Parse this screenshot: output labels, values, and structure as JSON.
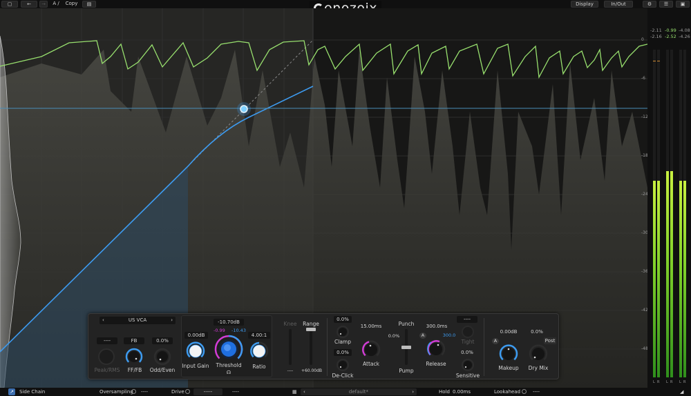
{
  "app": {
    "logo_text": "enozoix"
  },
  "toolbar": {
    "ab_label": "A /",
    "copy_label": "Copy",
    "display_label": "Display",
    "inout_label": "In/Out"
  },
  "graph": {
    "db_labels": [
      "0",
      "-6",
      "-12",
      "-18",
      "-24",
      "-30",
      "-36",
      "-42",
      "-48"
    ]
  },
  "meters": {
    "values_row1": [
      "-2.11",
      "-0.99",
      "-4.08"
    ],
    "values_row2": [
      "-2.16",
      "-2.52",
      "-4.26"
    ],
    "channel_labels": [
      "L",
      "R",
      "L",
      "R",
      "L",
      "R"
    ],
    "levels": [
      0.6,
      0.6,
      0.63,
      0.63,
      0.6,
      0.6
    ]
  },
  "panel": {
    "detector_mode": "US VCA",
    "peak_rms_value": "----",
    "peak_rms_label": "Peak/RMS",
    "fffb_value": "FB",
    "fffb_label": "FF/FB",
    "odd_even_value": "0.0%",
    "odd_even_label": "Odd/Even",
    "threshold_value": "-10.70dB",
    "threshold_left": "-0.99",
    "threshold_right": "-10.43",
    "threshold_label": "Threshold",
    "input_gain_value": "0.00dB",
    "input_gain_label": "Input Gain",
    "ratio_value": "4.00:1",
    "ratio_label": "Ratio",
    "knee_label": "Knee",
    "knee_value": "----",
    "range_label": "Range",
    "range_value": "+60.00dB",
    "clamp_value": "0.0%",
    "clamp_label": "Clamp",
    "declick_value": "0.0%",
    "declick_label": "De-Click",
    "attack_value": "15.00ms",
    "attack_label": "Attack",
    "punch_label": "Punch",
    "pump_label": "Pump",
    "punch_pump_value": "0.0%",
    "release_value": "300.0ms",
    "release_auto": "A",
    "release_auto_value": "300.0",
    "release_label": "Release",
    "tight_value": "----",
    "tight_label": "Tight",
    "sensitive_value": "0.0%",
    "sensitive_label": "Sensitive",
    "makeup_value": "0.00dB",
    "makeup_auto": "A",
    "makeup_label": "Makeup",
    "drymix_value": "0.0%",
    "drymix_label": "Dry Mix",
    "post_label": "Post"
  },
  "bottom": {
    "sidechain_label": "Side Chain",
    "oversampling_label": "Oversampling",
    "oversampling_value": "----",
    "drive_label": "Drive",
    "drive_value": "-----",
    "drive_value2": "----",
    "preset_name": "default*",
    "hold_label": "Hold",
    "hold_value": "0.00ms",
    "lookahead_label": "Lookahead",
    "lookahead_value": "----"
  },
  "colors": {
    "accent_blue": "#3d9bf0",
    "accent_magenta": "#d23cd6",
    "gr_green": "#98e06e",
    "bg": "#1b1b1b"
  }
}
